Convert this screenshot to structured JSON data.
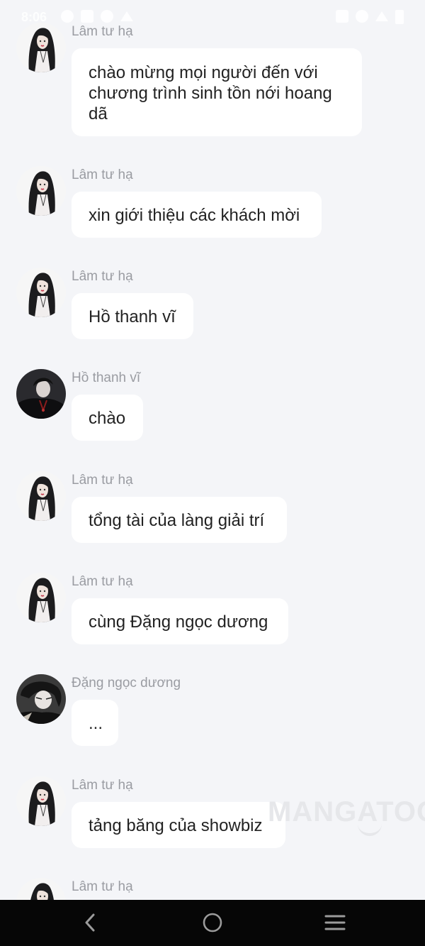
{
  "status_bar": {
    "time": "8:06"
  },
  "watermark": "MANGATOON",
  "messages": [
    {
      "sender": "Lâm tư hạ",
      "avatar": "female-character-avatar",
      "text": "chào mừng mọi người đến với chương trình sinh tồn nới hoang dã"
    },
    {
      "sender": "Lâm tư hạ",
      "avatar": "female-character-avatar",
      "text": "xin giới thiệu các khách mời"
    },
    {
      "sender": "Lâm tư hạ",
      "avatar": "female-character-avatar",
      "text": "Hồ thanh vĩ"
    },
    {
      "sender": "Hồ thanh vĩ",
      "avatar": "male-character-avatar",
      "text": "chào"
    },
    {
      "sender": "Lâm tư hạ",
      "avatar": "female-character-avatar",
      "text": "tổng tài của làng giải trí"
    },
    {
      "sender": "Lâm tư hạ",
      "avatar": "female-character-avatar",
      "text": "cùng Đặng ngọc dương"
    },
    {
      "sender": "Đặng ngọc dương",
      "avatar": "male-character-avatar-2",
      "text": "..."
    },
    {
      "sender": "Lâm tư hạ",
      "avatar": "female-character-avatar",
      "text": "tảng băng của showbiz"
    },
    {
      "sender": "Lâm tư hạ",
      "avatar": "female-character-avatar",
      "text": ""
    }
  ],
  "nav_bar": {
    "buttons": [
      "back-icon",
      "home-icon",
      "menu-icon"
    ]
  }
}
